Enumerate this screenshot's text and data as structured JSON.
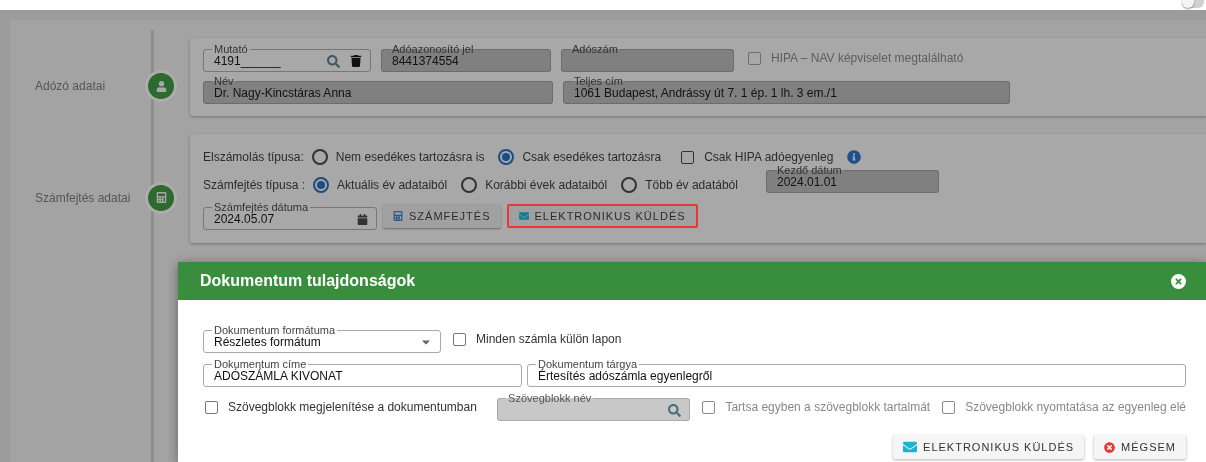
{
  "top_toggle": {
    "on": false
  },
  "taxpayer": {
    "label": "Adózó adatai",
    "mutato": {
      "label": "Mutató",
      "value": "4191______"
    },
    "tax_id": {
      "label": "Adóazonosító jel",
      "value": "8441374554"
    },
    "tax_number": {
      "label": "Adószám"
    },
    "hipa_nav": {
      "label": "HIPA – NAV képviselet megtalálható",
      "checked": false,
      "disabled": true
    },
    "name": {
      "label": "Név",
      "value": "Dr. Nagy-Kincstáras Anna"
    },
    "address": {
      "label": "Teljes cím",
      "value": "1061 Budapest, Andrássy út 7. 1 ép. 1 lh. 3 em./1"
    }
  },
  "calculation": {
    "label": "Számfejtés adatai",
    "settlement_type": {
      "label": "Elszámolás típusa:",
      "options": [
        {
          "label": "Nem esedékes tartozásra is",
          "selected": false
        },
        {
          "label": "Csak esedékes tartozásra",
          "selected": true
        }
      ]
    },
    "hipa_only": {
      "label": "Csak HIPA adóegyenleg",
      "checked": false
    },
    "calc_type": {
      "label": "Számfejtés típusa :",
      "options": [
        {
          "label": "Aktuális év adataiból",
          "selected": true
        },
        {
          "label": "Korábbi évek adataiból",
          "selected": false
        },
        {
          "label": "Több év adatából",
          "selected": false
        }
      ]
    },
    "start_date": {
      "label": "Kezdő dátum",
      "value": "2024.01.01"
    },
    "calc_date": {
      "label": "Számfejtés dátuma",
      "value": "2024.05.07"
    },
    "buttons": [
      {
        "kind": "calculate",
        "label": "SZÁMFEJTÉS",
        "highlighted": false
      },
      {
        "kind": "send",
        "label": "ELEKTRONIKUS KÜLDÉS",
        "highlighted": true
      }
    ]
  },
  "dialog": {
    "title": "Dokumentum tulajdonságok",
    "format": {
      "label": "Dokumentum formátuma",
      "value": "Részletes formátum"
    },
    "separate_pages": {
      "label": "Minden számla külön lapon",
      "checked": false,
      "disabled": false
    },
    "doc_title": {
      "label": "Dokumentum címe",
      "value": "ADÓSZÁMLA KIVONAT"
    },
    "doc_subject": {
      "label": "Dokumentum tárgya",
      "value": "Értesítés adószámla egyenlegről"
    },
    "show_textblock": {
      "label": "Szövegblokk megjelenítése a dokumentumban",
      "checked": false,
      "disabled": false
    },
    "textblock_name": {
      "label": "Szövegblokk név"
    },
    "keep_together": {
      "label": "Tartsa egyben a szövegblokk tartalmát",
      "checked": false,
      "disabled": true
    },
    "print_before": {
      "label": "Szövegblokk nyomtatása az egyenleg elé",
      "checked": false,
      "disabled": true
    },
    "buttons": [
      {
        "kind": "send",
        "label": "ELEKTRONIKUS KÜLDÉS"
      },
      {
        "kind": "cancel",
        "label": "MÉGSEM"
      }
    ]
  }
}
